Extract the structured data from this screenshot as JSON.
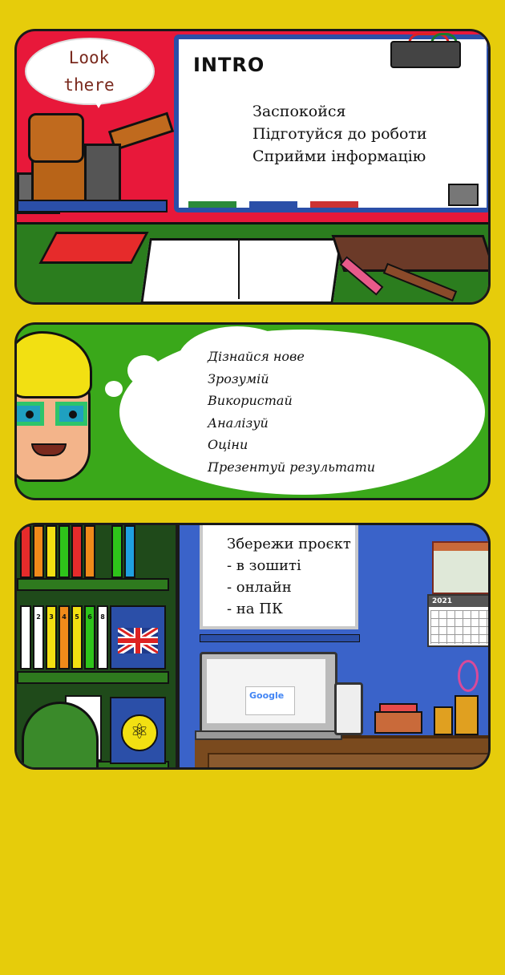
{
  "panel1": {
    "speech": [
      "Look",
      "there"
    ],
    "board": {
      "title": "INTRO",
      "lines": [
        "Заспокойся",
        "Підготуйся до роботи",
        "Сприйми інформацію"
      ]
    }
  },
  "panel2": {
    "thought_lines": [
      "Дізнайся нове",
      "Зрозумій",
      "Використай",
      "Аналізуй",
      "Оціни",
      "Презентуй результати"
    ]
  },
  "panel3": {
    "poster_lines": [
      "Збережи проєкт",
      "- в зошиті",
      "- онлайн",
      "- на ПК"
    ],
    "binder_numbers": [
      "2",
      "3",
      "4",
      "5",
      "6",
      "8",
      "9"
    ],
    "calendar_year": "2021",
    "screen_logo": "Google"
  },
  "colors": {
    "background": "#e6cc0b",
    "panel1_bg": "#e8183a",
    "panel2_bg": "#3aa81a",
    "panel3_bg": "#3a63c9"
  },
  "icons": [
    "projector-icon",
    "uk-flag-icon",
    "atom-icon",
    "calendar-icon",
    "laptop-icon",
    "phone-icon"
  ]
}
